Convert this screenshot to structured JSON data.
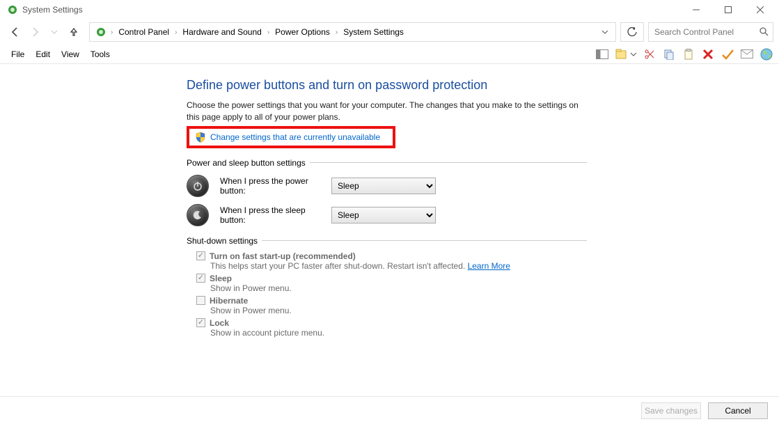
{
  "window": {
    "title": "System Settings",
    "controls": {
      "min": "minimize",
      "max": "maximize",
      "close": "close"
    }
  },
  "breadcrumb": {
    "items": [
      "Control Panel",
      "Hardware and Sound",
      "Power Options",
      "System Settings"
    ]
  },
  "search": {
    "placeholder": "Search Control Panel"
  },
  "menu": {
    "items": [
      "File",
      "Edit",
      "View",
      "Tools"
    ]
  },
  "page": {
    "heading": "Define power buttons and turn on password protection",
    "intro": "Choose the power settings that you want for your computer. The changes that you make to the settings on this page apply to all of your power plans.",
    "change_link": "Change settings that are currently unavailable",
    "section1": "Power and sleep button settings",
    "power_label": "When I press the power button:",
    "power_value": "Sleep",
    "sleep_label": "When I press the sleep button:",
    "sleep_value": "Sleep",
    "section2": "Shut-down settings",
    "items": [
      {
        "label": "Turn on fast start-up (recommended)",
        "checked": true,
        "desc_before": "This helps start your PC faster after shut-down. Restart isn't affected. ",
        "learn": "Learn More"
      },
      {
        "label": "Sleep",
        "checked": true,
        "desc": "Show in Power menu."
      },
      {
        "label": "Hibernate",
        "checked": false,
        "desc": "Show in Power menu."
      },
      {
        "label": "Lock",
        "checked": true,
        "desc": "Show in account picture menu."
      }
    ]
  },
  "footer": {
    "save": "Save changes",
    "cancel": "Cancel"
  }
}
